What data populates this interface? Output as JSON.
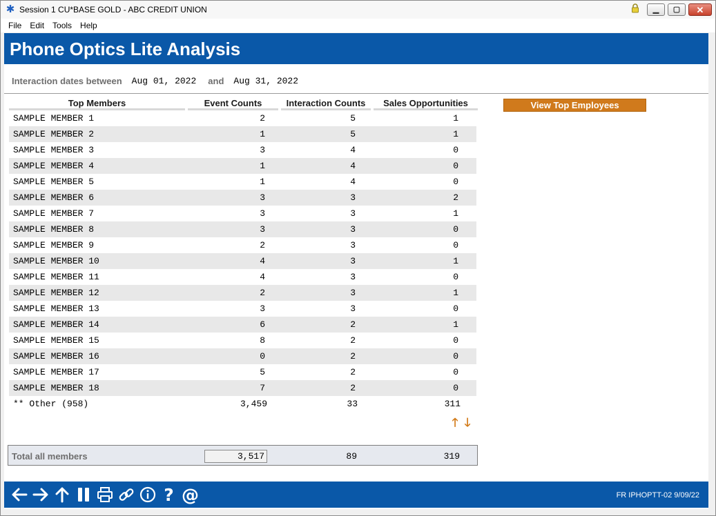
{
  "window": {
    "title": "Session 1 CU*BASE GOLD - ABC CREDIT UNION",
    "icons": [
      "app-icon",
      "lock-icon",
      "minimize-icon",
      "maximize-icon",
      "close-icon"
    ]
  },
  "menu": [
    "File",
    "Edit",
    "Tools",
    "Help"
  ],
  "page": {
    "title": "Phone Optics Lite Analysis",
    "dates_label": "Interaction dates between",
    "date_from": "Aug 01, 2022",
    "and_label": "and",
    "date_to": "Aug 31, 2022"
  },
  "table": {
    "headers": {
      "name": "Top Members",
      "event": "Event Counts",
      "interaction": "Interaction Counts",
      "sales": "Sales Opportunities"
    },
    "rows": [
      {
        "name": "SAMPLE MEMBER 1",
        "event": "2",
        "interaction": "5",
        "sales": "1"
      },
      {
        "name": "SAMPLE MEMBER 2",
        "event": "1",
        "interaction": "5",
        "sales": "1"
      },
      {
        "name": "SAMPLE MEMBER 3",
        "event": "3",
        "interaction": "4",
        "sales": "0"
      },
      {
        "name": "SAMPLE MEMBER 4",
        "event": "1",
        "interaction": "4",
        "sales": "0"
      },
      {
        "name": "SAMPLE MEMBER 5",
        "event": "1",
        "interaction": "4",
        "sales": "0"
      },
      {
        "name": "SAMPLE MEMBER 6",
        "event": "3",
        "interaction": "3",
        "sales": "2"
      },
      {
        "name": "SAMPLE MEMBER 7",
        "event": "3",
        "interaction": "3",
        "sales": "1"
      },
      {
        "name": "SAMPLE MEMBER 8",
        "event": "3",
        "interaction": "3",
        "sales": "0"
      },
      {
        "name": "SAMPLE MEMBER 9",
        "event": "2",
        "interaction": "3",
        "sales": "0"
      },
      {
        "name": "SAMPLE MEMBER 10",
        "event": "4",
        "interaction": "3",
        "sales": "1"
      },
      {
        "name": "SAMPLE MEMBER 11",
        "event": "4",
        "interaction": "3",
        "sales": "0"
      },
      {
        "name": "SAMPLE MEMBER 12",
        "event": "2",
        "interaction": "3",
        "sales": "1"
      },
      {
        "name": "SAMPLE MEMBER 13",
        "event": "3",
        "interaction": "3",
        "sales": "0"
      },
      {
        "name": "SAMPLE MEMBER 14",
        "event": "6",
        "interaction": "2",
        "sales": "1"
      },
      {
        "name": "SAMPLE MEMBER 15",
        "event": "8",
        "interaction": "2",
        "sales": "0"
      },
      {
        "name": "SAMPLE MEMBER 16",
        "event": "0",
        "interaction": "2",
        "sales": "0"
      },
      {
        "name": "SAMPLE MEMBER 17",
        "event": "5",
        "interaction": "2",
        "sales": "0"
      },
      {
        "name": "SAMPLE MEMBER 18",
        "event": "7",
        "interaction": "2",
        "sales": "0"
      }
    ],
    "other": {
      "name": "** Other (958)",
      "event": "3,459",
      "interaction": "33",
      "sales": "311"
    }
  },
  "buttons": {
    "view_top_employees": "View Top Employees"
  },
  "scroll": {
    "icons": [
      "arrow-up-icon",
      "arrow-down-icon"
    ]
  },
  "totals": {
    "label": "Total all members",
    "event": "3,517",
    "interaction": "89",
    "sales": "319"
  },
  "footer": {
    "icons": [
      "back-arrow-icon",
      "forward-arrow-icon",
      "up-arrow-icon",
      "pause-icon",
      "print-icon",
      "link-icon",
      "info-icon",
      "help-icon",
      "at-sign-icon"
    ],
    "screen_code": "FR IPHOPTT-02 9/09/22"
  },
  "colors": {
    "header_blue": "#0a58a8",
    "accent_orange": "#d07a1c"
  }
}
